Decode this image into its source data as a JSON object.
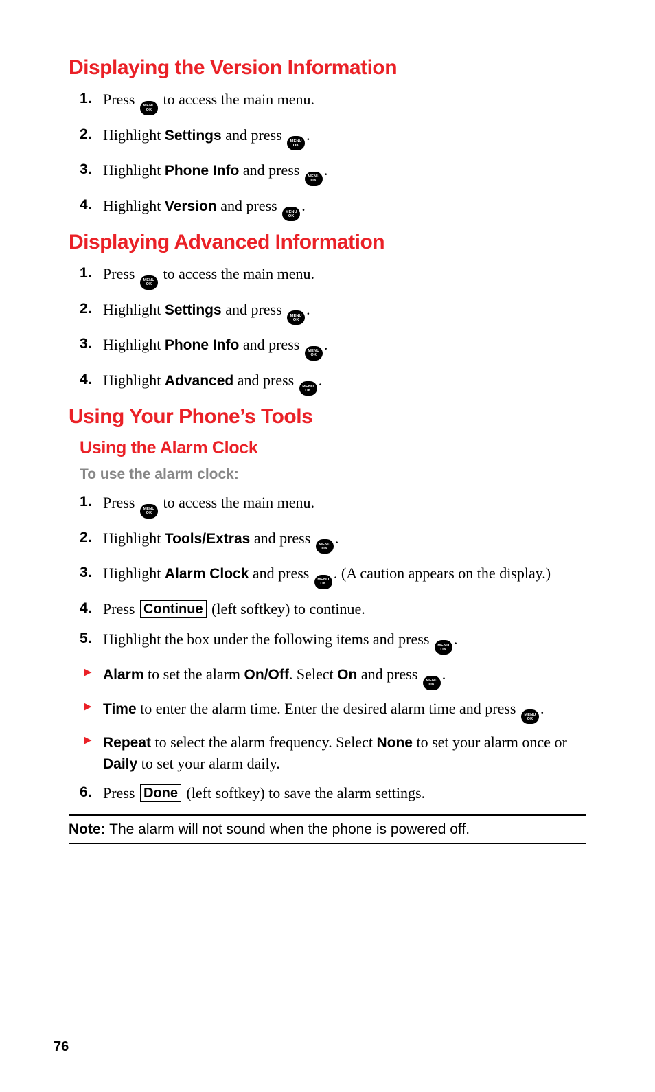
{
  "page_number": "76",
  "sections": [
    {
      "heading": "Displaying the Version Information",
      "steps": [
        {
          "num": "1.",
          "parts": [
            {
              "t": "text",
              "v": "Press "
            },
            {
              "t": "icon"
            },
            {
              "t": "text",
              "v": " to access the main menu."
            }
          ]
        },
        {
          "num": "2.",
          "parts": [
            {
              "t": "text",
              "v": "Highlight "
            },
            {
              "t": "bold",
              "v": "Settings"
            },
            {
              "t": "text",
              "v": " and press "
            },
            {
              "t": "icon"
            },
            {
              "t": "text",
              "v": "."
            }
          ]
        },
        {
          "num": "3.",
          "parts": [
            {
              "t": "text",
              "v": "Highlight "
            },
            {
              "t": "bold",
              "v": "Phone Info"
            },
            {
              "t": "text",
              "v": " and press "
            },
            {
              "t": "icon"
            },
            {
              "t": "text",
              "v": "."
            }
          ]
        },
        {
          "num": "4.",
          "parts": [
            {
              "t": "text",
              "v": "Highlight "
            },
            {
              "t": "bold",
              "v": "Version"
            },
            {
              "t": "text",
              "v": " and press "
            },
            {
              "t": "icon"
            },
            {
              "t": "text",
              "v": "."
            }
          ]
        }
      ]
    },
    {
      "heading": "Displaying Advanced Information",
      "steps": [
        {
          "num": "1.",
          "parts": [
            {
              "t": "text",
              "v": "Press "
            },
            {
              "t": "icon"
            },
            {
              "t": "text",
              "v": " to access the main menu."
            }
          ]
        },
        {
          "num": "2.",
          "parts": [
            {
              "t": "text",
              "v": "Highlight "
            },
            {
              "t": "bold",
              "v": "Settings"
            },
            {
              "t": "text",
              "v": " and press "
            },
            {
              "t": "icon"
            },
            {
              "t": "text",
              "v": "."
            }
          ]
        },
        {
          "num": "3.",
          "parts": [
            {
              "t": "text",
              "v": "Highlight "
            },
            {
              "t": "bold",
              "v": "Phone Info"
            },
            {
              "t": "text",
              "v": " and press "
            },
            {
              "t": "icon"
            },
            {
              "t": "text",
              "v": "."
            }
          ]
        },
        {
          "num": "4.",
          "parts": [
            {
              "t": "text",
              "v": "Highlight "
            },
            {
              "t": "bold",
              "v": "Advanced"
            },
            {
              "t": "text",
              "v": " and press "
            },
            {
              "t": "icon"
            },
            {
              "t": "text",
              "v": "."
            }
          ]
        }
      ]
    },
    {
      "heading": "Using Your Phone’s Tools",
      "sub": {
        "subheading": "Using the Alarm Clock",
        "lead": "To use the alarm clock:",
        "steps": [
          {
            "num": "1.",
            "parts": [
              {
                "t": "text",
                "v": "Press "
              },
              {
                "t": "icon"
              },
              {
                "t": "text",
                "v": " to access the main menu."
              }
            ]
          },
          {
            "num": "2.",
            "parts": [
              {
                "t": "text",
                "v": "Highlight "
              },
              {
                "t": "bold",
                "v": "Tools/Extras"
              },
              {
                "t": "text",
                "v": " and press "
              },
              {
                "t": "icon"
              },
              {
                "t": "text",
                "v": "."
              }
            ]
          },
          {
            "num": "3.",
            "parts": [
              {
                "t": "text",
                "v": "Highlight "
              },
              {
                "t": "bold",
                "v": "Alarm Clock"
              },
              {
                "t": "text",
                "v": " and press "
              },
              {
                "t": "icon"
              },
              {
                "t": "text",
                "v": ". (A caution appears on the display.)"
              }
            ]
          },
          {
            "num": "4.",
            "parts": [
              {
                "t": "text",
                "v": "Press "
              },
              {
                "t": "softkey",
                "v": "Continue"
              },
              {
                "t": "text",
                "v": " (left softkey) to continue."
              }
            ]
          },
          {
            "num": "5.",
            "parts": [
              {
                "t": "text",
                "v": "Highlight the box under the following items and press "
              },
              {
                "t": "icon"
              },
              {
                "t": "text",
                "v": "."
              }
            ]
          }
        ],
        "bullets": [
          {
            "parts": [
              {
                "t": "bold",
                "v": "Alarm"
              },
              {
                "t": "text",
                "v": " to set the alarm "
              },
              {
                "t": "bold",
                "v": "On/Off"
              },
              {
                "t": "text",
                "v": ". Select "
              },
              {
                "t": "bold",
                "v": "On"
              },
              {
                "t": "text",
                "v": " and press "
              },
              {
                "t": "icon"
              },
              {
                "t": "text",
                "v": "."
              }
            ]
          },
          {
            "parts": [
              {
                "t": "bold",
                "v": "Time"
              },
              {
                "t": "text",
                "v": " to enter the alarm time. Enter the desired alarm time and press "
              },
              {
                "t": "icon"
              },
              {
                "t": "text",
                "v": "."
              }
            ]
          },
          {
            "parts": [
              {
                "t": "bold",
                "v": "Repeat"
              },
              {
                "t": "text",
                "v": " to select the alarm frequency. Select "
              },
              {
                "t": "bold",
                "v": "None"
              },
              {
                "t": "text",
                "v": " to set your alarm once or "
              },
              {
                "t": "bold",
                "v": "Daily"
              },
              {
                "t": "text",
                "v": " to set your alarm daily."
              }
            ]
          }
        ],
        "steps_after": [
          {
            "num": "6.",
            "parts": [
              {
                "t": "text",
                "v": "Press "
              },
              {
                "t": "softkey",
                "v": "Done"
              },
              {
                "t": "text",
                "v": " (left softkey) to save the alarm settings."
              }
            ]
          }
        ]
      }
    }
  ],
  "note": {
    "label": "Note:",
    "text": " The alarm will not sound when the phone is powered off."
  }
}
